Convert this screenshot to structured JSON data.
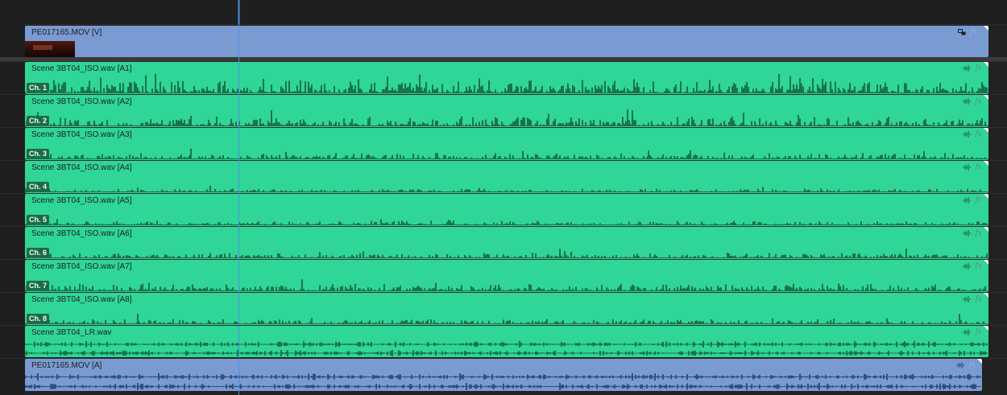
{
  "video_track": {
    "clip_name": "PE017165.MOV [V]",
    "fx_label": "fx",
    "icon": "clip-link-icon"
  },
  "audio_tracks": [
    {
      "clip_name": "Scene 3BT04_ISO.wav [A1]",
      "channel": "Ch. 1",
      "level": 0.85
    },
    {
      "clip_name": "Scene 3BT04_ISO.wav [A2]",
      "channel": "Ch. 2",
      "level": 0.55
    },
    {
      "clip_name": "Scene 3BT04_ISO.wav [A3]",
      "channel": "Ch. 3",
      "level": 0.35
    },
    {
      "clip_name": "Scene 3BT04_ISO.wav [A4]",
      "channel": "Ch. 4",
      "level": 0.2
    },
    {
      "clip_name": "Scene 3BT04_ISO.wav [A5]",
      "channel": "Ch. 5",
      "level": 0.25
    },
    {
      "clip_name": "Scene 3BT04_ISO.wav [A6]",
      "channel": "Ch. 6",
      "level": 0.3
    },
    {
      "clip_name": "Scene 3BT04_ISO.wav [A7]",
      "channel": "Ch. 7",
      "level": 0.45
    },
    {
      "clip_name": "Scene 3BT04_ISO.wav [A8]",
      "channel": "Ch. 8",
      "level": 0.3
    }
  ],
  "lr_track": {
    "clip_name": "Scene 3BT04_LR.wav"
  },
  "mov_audio_track": {
    "clip_name": "PE017165.MOV [A]"
  },
  "fx_label": "fx",
  "colors": {
    "audio_clip": "#2fd697",
    "audio_wave": "#145c36",
    "video_clip": "#7a9bd1",
    "mov_wave": "#1f3c6e",
    "playhead": "#4f8fe0"
  }
}
